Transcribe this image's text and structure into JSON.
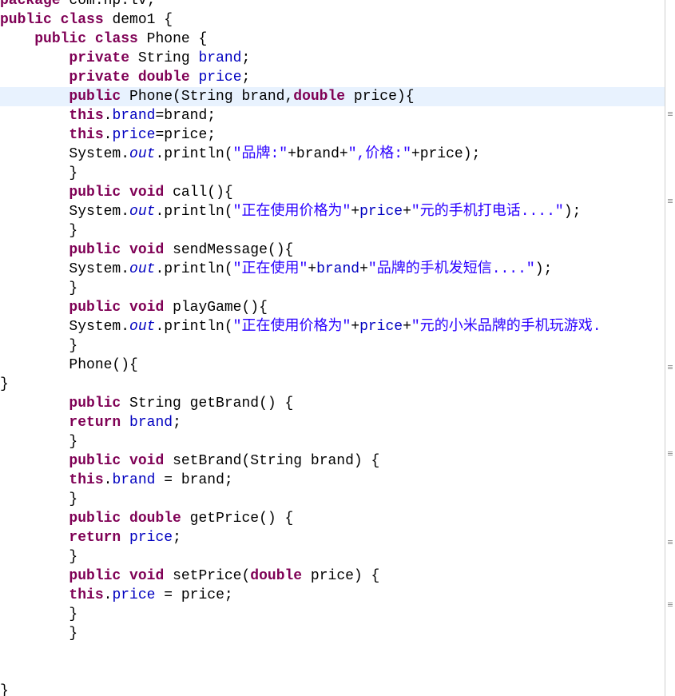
{
  "editor": {
    "language": "java",
    "lines": [
      [
        {
          "t": "package",
          "s": "kw"
        },
        {
          "t": " com.hp.lv;",
          "s": "pl"
        }
      ],
      [
        {
          "t": "public",
          "s": "kw"
        },
        {
          "t": " ",
          "s": "pl"
        },
        {
          "t": "class",
          "s": "kw"
        },
        {
          "t": " demo1 {",
          "s": "pl"
        }
      ],
      [
        {
          "t": "    ",
          "s": "pl"
        },
        {
          "t": "public",
          "s": "kw"
        },
        {
          "t": " ",
          "s": "pl"
        },
        {
          "t": "class",
          "s": "kw"
        },
        {
          "t": " Phone {",
          "s": "pl"
        }
      ],
      [
        {
          "t": "        ",
          "s": "pl"
        },
        {
          "t": "private",
          "s": "kw"
        },
        {
          "t": " String ",
          "s": "pl"
        },
        {
          "t": "brand",
          "s": "fld"
        },
        {
          "t": ";",
          "s": "pl"
        }
      ],
      [
        {
          "t": "        ",
          "s": "pl"
        },
        {
          "t": "private",
          "s": "kw"
        },
        {
          "t": " ",
          "s": "pl"
        },
        {
          "t": "double",
          "s": "kw"
        },
        {
          "t": " ",
          "s": "pl"
        },
        {
          "t": "price",
          "s": "fld"
        },
        {
          "t": ";",
          "s": "pl"
        }
      ],
      [
        {
          "t": "        ",
          "s": "pl"
        },
        {
          "t": "public",
          "s": "kw"
        },
        {
          "t": " Phone(String brand,",
          "s": "pl"
        },
        {
          "t": "double",
          "s": "kw"
        },
        {
          "t": " price){",
          "s": "pl"
        }
      ],
      [
        {
          "t": "        ",
          "s": "pl"
        },
        {
          "t": "this",
          "s": "kw"
        },
        {
          "t": ".",
          "s": "pl"
        },
        {
          "t": "brand",
          "s": "fld"
        },
        {
          "t": "=brand;",
          "s": "pl"
        }
      ],
      [
        {
          "t": "        ",
          "s": "pl"
        },
        {
          "t": "this",
          "s": "kw"
        },
        {
          "t": ".",
          "s": "pl"
        },
        {
          "t": "price",
          "s": "fld"
        },
        {
          "t": "=price;",
          "s": "pl"
        }
      ],
      [
        {
          "t": "        System.",
          "s": "pl"
        },
        {
          "t": "out",
          "s": "st"
        },
        {
          "t": ".println(",
          "s": "pl"
        },
        {
          "t": "\"品牌:\"",
          "s": "str"
        },
        {
          "t": "+brand+",
          "s": "pl"
        },
        {
          "t": "\",价格:\"",
          "s": "str"
        },
        {
          "t": "+price);",
          "s": "pl"
        }
      ],
      [
        {
          "t": "        }",
          "s": "pl"
        }
      ],
      [
        {
          "t": "        ",
          "s": "pl"
        },
        {
          "t": "public",
          "s": "kw"
        },
        {
          "t": " ",
          "s": "pl"
        },
        {
          "t": "void",
          "s": "kw"
        },
        {
          "t": " call(){",
          "s": "pl"
        }
      ],
      [
        {
          "t": "        System.",
          "s": "pl"
        },
        {
          "t": "out",
          "s": "st"
        },
        {
          "t": ".println(",
          "s": "pl"
        },
        {
          "t": "\"正在使用价格为\"",
          "s": "str"
        },
        {
          "t": "+",
          "s": "pl"
        },
        {
          "t": "price",
          "s": "fld"
        },
        {
          "t": "+",
          "s": "pl"
        },
        {
          "t": "\"元的手机打电话....\"",
          "s": "str"
        },
        {
          "t": ");",
          "s": "pl"
        }
      ],
      [
        {
          "t": "        }",
          "s": "pl"
        }
      ],
      [
        {
          "t": "        ",
          "s": "pl"
        },
        {
          "t": "public",
          "s": "kw"
        },
        {
          "t": " ",
          "s": "pl"
        },
        {
          "t": "void",
          "s": "kw"
        },
        {
          "t": " sendMessage(){",
          "s": "pl"
        }
      ],
      [
        {
          "t": "        System.",
          "s": "pl"
        },
        {
          "t": "out",
          "s": "st"
        },
        {
          "t": ".println(",
          "s": "pl"
        },
        {
          "t": "\"正在使用\"",
          "s": "str"
        },
        {
          "t": "+",
          "s": "pl"
        },
        {
          "t": "brand",
          "s": "fld"
        },
        {
          "t": "+",
          "s": "pl"
        },
        {
          "t": "\"品牌的手机发短信....\"",
          "s": "str"
        },
        {
          "t": ");",
          "s": "pl"
        }
      ],
      [
        {
          "t": "        }",
          "s": "pl"
        }
      ],
      [
        {
          "t": "        ",
          "s": "pl"
        },
        {
          "t": "public",
          "s": "kw"
        },
        {
          "t": " ",
          "s": "pl"
        },
        {
          "t": "void",
          "s": "kw"
        },
        {
          "t": " playGame(){",
          "s": "pl"
        }
      ],
      [
        {
          "t": "        System.",
          "s": "pl"
        },
        {
          "t": "out",
          "s": "st"
        },
        {
          "t": ".println(",
          "s": "pl"
        },
        {
          "t": "\"正在使用价格为\"",
          "s": "str"
        },
        {
          "t": "+",
          "s": "pl"
        },
        {
          "t": "price",
          "s": "fld"
        },
        {
          "t": "+",
          "s": "pl"
        },
        {
          "t": "\"元的小米品牌的手机玩游戏.",
          "s": "str"
        }
      ],
      [
        {
          "t": "        }",
          "s": "pl"
        }
      ],
      [
        {
          "t": "        Phone(){",
          "s": "pl"
        }
      ],
      [
        {
          "t": "}",
          "s": "pl"
        }
      ],
      [
        {
          "t": "        ",
          "s": "pl"
        },
        {
          "t": "public",
          "s": "kw"
        },
        {
          "t": " String getBrand() {",
          "s": "pl"
        }
      ],
      [
        {
          "t": "        ",
          "s": "pl"
        },
        {
          "t": "return",
          "s": "kw"
        },
        {
          "t": " ",
          "s": "pl"
        },
        {
          "t": "brand",
          "s": "fld"
        },
        {
          "t": ";",
          "s": "pl"
        }
      ],
      [
        {
          "t": "        }",
          "s": "pl"
        }
      ],
      [
        {
          "t": "        ",
          "s": "pl"
        },
        {
          "t": "public",
          "s": "kw"
        },
        {
          "t": " ",
          "s": "pl"
        },
        {
          "t": "void",
          "s": "kw"
        },
        {
          "t": " setBrand(String brand) {",
          "s": "pl"
        }
      ],
      [
        {
          "t": "        ",
          "s": "pl"
        },
        {
          "t": "this",
          "s": "kw"
        },
        {
          "t": ".",
          "s": "pl"
        },
        {
          "t": "brand",
          "s": "fld"
        },
        {
          "t": " = brand;",
          "s": "pl"
        }
      ],
      [
        {
          "t": "        }",
          "s": "pl"
        }
      ],
      [
        {
          "t": "        ",
          "s": "pl"
        },
        {
          "t": "public",
          "s": "kw"
        },
        {
          "t": " ",
          "s": "pl"
        },
        {
          "t": "double",
          "s": "kw"
        },
        {
          "t": " getPrice() {",
          "s": "pl"
        }
      ],
      [
        {
          "t": "        ",
          "s": "pl"
        },
        {
          "t": "return",
          "s": "kw"
        },
        {
          "t": " ",
          "s": "pl"
        },
        {
          "t": "price",
          "s": "fld"
        },
        {
          "t": ";",
          "s": "pl"
        }
      ],
      [
        {
          "t": "        }",
          "s": "pl"
        }
      ],
      [
        {
          "t": "        ",
          "s": "pl"
        },
        {
          "t": "public",
          "s": "kw"
        },
        {
          "t": " ",
          "s": "pl"
        },
        {
          "t": "void",
          "s": "kw"
        },
        {
          "t": " setPrice(",
          "s": "pl"
        },
        {
          "t": "double",
          "s": "kw"
        },
        {
          "t": " price) {",
          "s": "pl"
        }
      ],
      [
        {
          "t": "        ",
          "s": "pl"
        },
        {
          "t": "this",
          "s": "kw"
        },
        {
          "t": ".",
          "s": "pl"
        },
        {
          "t": "price",
          "s": "fld"
        },
        {
          "t": " = price;",
          "s": "pl"
        }
      ],
      [
        {
          "t": "        }",
          "s": "pl"
        }
      ],
      [
        {
          "t": "        }",
          "s": "pl"
        }
      ],
      [
        {
          "t": "",
          "s": "pl"
        }
      ],
      [
        {
          "t": "",
          "s": "pl"
        }
      ],
      [
        {
          "t": "}",
          "s": "pl"
        }
      ]
    ],
    "current_line_index": 5,
    "colors": {
      "keyword": "#7f0055",
      "field": "#0000c0",
      "string": "#2a00ff",
      "current_line": "#e8f2fe"
    }
  },
  "overview_ruler": {
    "marker_icon": "occurrence-mark-icon",
    "marker_count": 6
  }
}
